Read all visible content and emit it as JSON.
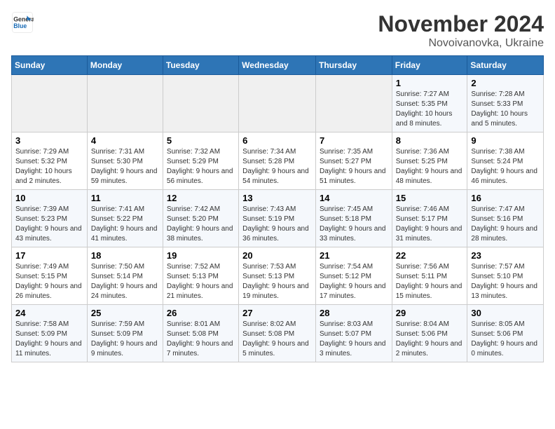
{
  "logo": {
    "line1": "General",
    "line2": "Blue"
  },
  "title": "November 2024",
  "location": "Novoivanovka, Ukraine",
  "weekdays": [
    "Sunday",
    "Monday",
    "Tuesday",
    "Wednesday",
    "Thursday",
    "Friday",
    "Saturday"
  ],
  "weeks": [
    [
      {
        "day": "",
        "info": ""
      },
      {
        "day": "",
        "info": ""
      },
      {
        "day": "",
        "info": ""
      },
      {
        "day": "",
        "info": ""
      },
      {
        "day": "",
        "info": ""
      },
      {
        "day": "1",
        "info": "Sunrise: 7:27 AM\nSunset: 5:35 PM\nDaylight: 10 hours and 8 minutes."
      },
      {
        "day": "2",
        "info": "Sunrise: 7:28 AM\nSunset: 5:33 PM\nDaylight: 10 hours and 5 minutes."
      }
    ],
    [
      {
        "day": "3",
        "info": "Sunrise: 7:29 AM\nSunset: 5:32 PM\nDaylight: 10 hours and 2 minutes."
      },
      {
        "day": "4",
        "info": "Sunrise: 7:31 AM\nSunset: 5:30 PM\nDaylight: 9 hours and 59 minutes."
      },
      {
        "day": "5",
        "info": "Sunrise: 7:32 AM\nSunset: 5:29 PM\nDaylight: 9 hours and 56 minutes."
      },
      {
        "day": "6",
        "info": "Sunrise: 7:34 AM\nSunset: 5:28 PM\nDaylight: 9 hours and 54 minutes."
      },
      {
        "day": "7",
        "info": "Sunrise: 7:35 AM\nSunset: 5:27 PM\nDaylight: 9 hours and 51 minutes."
      },
      {
        "day": "8",
        "info": "Sunrise: 7:36 AM\nSunset: 5:25 PM\nDaylight: 9 hours and 48 minutes."
      },
      {
        "day": "9",
        "info": "Sunrise: 7:38 AM\nSunset: 5:24 PM\nDaylight: 9 hours and 46 minutes."
      }
    ],
    [
      {
        "day": "10",
        "info": "Sunrise: 7:39 AM\nSunset: 5:23 PM\nDaylight: 9 hours and 43 minutes."
      },
      {
        "day": "11",
        "info": "Sunrise: 7:41 AM\nSunset: 5:22 PM\nDaylight: 9 hours and 41 minutes."
      },
      {
        "day": "12",
        "info": "Sunrise: 7:42 AM\nSunset: 5:20 PM\nDaylight: 9 hours and 38 minutes."
      },
      {
        "day": "13",
        "info": "Sunrise: 7:43 AM\nSunset: 5:19 PM\nDaylight: 9 hours and 36 minutes."
      },
      {
        "day": "14",
        "info": "Sunrise: 7:45 AM\nSunset: 5:18 PM\nDaylight: 9 hours and 33 minutes."
      },
      {
        "day": "15",
        "info": "Sunrise: 7:46 AM\nSunset: 5:17 PM\nDaylight: 9 hours and 31 minutes."
      },
      {
        "day": "16",
        "info": "Sunrise: 7:47 AM\nSunset: 5:16 PM\nDaylight: 9 hours and 28 minutes."
      }
    ],
    [
      {
        "day": "17",
        "info": "Sunrise: 7:49 AM\nSunset: 5:15 PM\nDaylight: 9 hours and 26 minutes."
      },
      {
        "day": "18",
        "info": "Sunrise: 7:50 AM\nSunset: 5:14 PM\nDaylight: 9 hours and 24 minutes."
      },
      {
        "day": "19",
        "info": "Sunrise: 7:52 AM\nSunset: 5:13 PM\nDaylight: 9 hours and 21 minutes."
      },
      {
        "day": "20",
        "info": "Sunrise: 7:53 AM\nSunset: 5:13 PM\nDaylight: 9 hours and 19 minutes."
      },
      {
        "day": "21",
        "info": "Sunrise: 7:54 AM\nSunset: 5:12 PM\nDaylight: 9 hours and 17 minutes."
      },
      {
        "day": "22",
        "info": "Sunrise: 7:56 AM\nSunset: 5:11 PM\nDaylight: 9 hours and 15 minutes."
      },
      {
        "day": "23",
        "info": "Sunrise: 7:57 AM\nSunset: 5:10 PM\nDaylight: 9 hours and 13 minutes."
      }
    ],
    [
      {
        "day": "24",
        "info": "Sunrise: 7:58 AM\nSunset: 5:09 PM\nDaylight: 9 hours and 11 minutes."
      },
      {
        "day": "25",
        "info": "Sunrise: 7:59 AM\nSunset: 5:09 PM\nDaylight: 9 hours and 9 minutes."
      },
      {
        "day": "26",
        "info": "Sunrise: 8:01 AM\nSunset: 5:08 PM\nDaylight: 9 hours and 7 minutes."
      },
      {
        "day": "27",
        "info": "Sunrise: 8:02 AM\nSunset: 5:08 PM\nDaylight: 9 hours and 5 minutes."
      },
      {
        "day": "28",
        "info": "Sunrise: 8:03 AM\nSunset: 5:07 PM\nDaylight: 9 hours and 3 minutes."
      },
      {
        "day": "29",
        "info": "Sunrise: 8:04 AM\nSunset: 5:06 PM\nDaylight: 9 hours and 2 minutes."
      },
      {
        "day": "30",
        "info": "Sunrise: 8:05 AM\nSunset: 5:06 PM\nDaylight: 9 hours and 0 minutes."
      }
    ]
  ]
}
